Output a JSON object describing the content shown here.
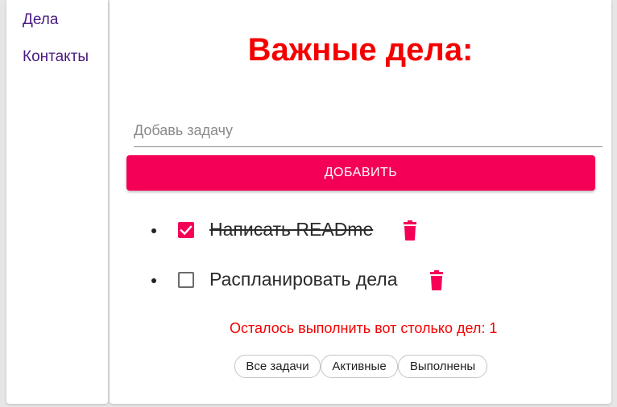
{
  "sidebar": {
    "items": [
      {
        "label": "Дела"
      },
      {
        "label": "Контакты"
      }
    ]
  },
  "main": {
    "title": "Важные дела:",
    "input": {
      "placeholder": "Добавь задачу",
      "value": ""
    },
    "add_button_label": "Добавить",
    "todos": [
      {
        "text": "Написать READme",
        "completed": true
      },
      {
        "text": "Распланировать дела",
        "completed": false
      }
    ],
    "remaining_text": "Осталось выполнить вот столько дел: 1",
    "filters": [
      {
        "label": "Все задачи"
      },
      {
        "label": "Активные"
      },
      {
        "label": "Выполнены"
      }
    ]
  },
  "colors": {
    "accent": "#f50057",
    "title": "#f50000",
    "nav_link": "#4a1a80"
  },
  "icons": {
    "checkbox_checked": "check-icon",
    "delete": "trash-icon"
  }
}
